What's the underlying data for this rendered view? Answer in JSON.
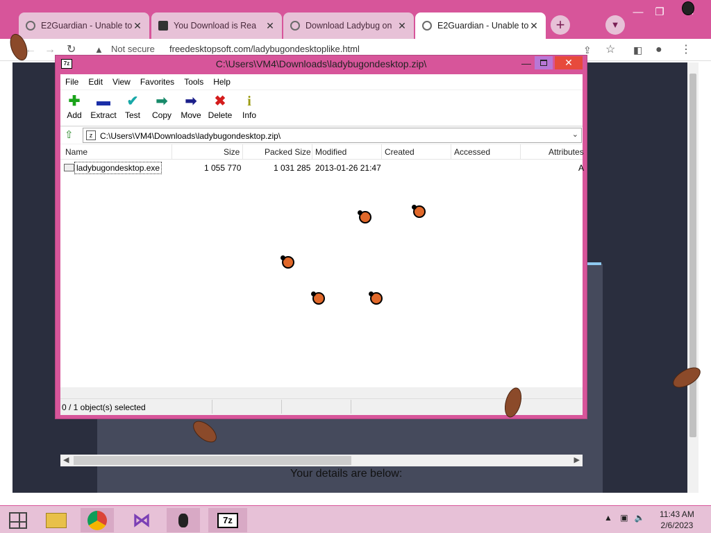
{
  "browser": {
    "tabs": [
      {
        "title": "E2Guardian - Unable to",
        "active": false
      },
      {
        "title": "You Download is Rea",
        "active": false
      },
      {
        "title": "Download Ladybug on",
        "active": false
      },
      {
        "title": "E2Guardian - Unable to",
        "active": true
      }
    ],
    "new_tab_glyph": "+",
    "not_secure_label": "Not secure",
    "url": "freedesktopsoft.com/ladybugondesktoplike.html",
    "page_details_text": "Your details are below:",
    "page_red_text": "-------------- -- -----------------"
  },
  "sevenzip": {
    "title": "C:\\Users\\VM4\\Downloads\\ladybugondesktop.zip\\",
    "menu": [
      "File",
      "Edit",
      "View",
      "Favorites",
      "Tools",
      "Help"
    ],
    "toolbar": [
      {
        "label": "Add",
        "icon": "add-icon",
        "glyph": "✚",
        "color": "#1aa31a"
      },
      {
        "label": "Extract",
        "icon": "extract-icon",
        "glyph": "▬",
        "color": "#1b2fa8"
      },
      {
        "label": "Test",
        "icon": "test-icon",
        "glyph": "✔",
        "color": "#18a8a8"
      },
      {
        "label": "Copy",
        "icon": "copy-icon",
        "glyph": "➡",
        "color": "#188a6a"
      },
      {
        "label": "Move",
        "icon": "move-icon",
        "glyph": "➡",
        "color": "#1b1f8a"
      },
      {
        "label": "Delete",
        "icon": "delete-icon",
        "glyph": "✖",
        "color": "#d41c1c"
      },
      {
        "label": "Info",
        "icon": "info-icon",
        "glyph": "i",
        "color": "#9a9a10"
      }
    ],
    "address": "C:\\Users\\VM4\\Downloads\\ladybugondesktop.zip\\",
    "columns": [
      "Name",
      "Size",
      "Packed Size",
      "Modified",
      "Created",
      "Accessed",
      "Attributes"
    ],
    "file": {
      "name": "ladybugondesktop.exe",
      "size": "1 055 770",
      "packed_size": "1 031 285",
      "modified": "2013-01-26 21:47",
      "attributes": "A"
    },
    "status": "0 / 1 object(s) selected"
  },
  "taskbar": {
    "items": [
      "start",
      "file-explorer",
      "chrome",
      "visual-studio",
      "ladybug-app",
      "7zip"
    ],
    "sevenzip_label": "7z",
    "time": "11:43 AM",
    "date": "2/6/2023"
  },
  "colors": {
    "accent": "#d7559a",
    "accent_light": "#e7c1d7"
  }
}
